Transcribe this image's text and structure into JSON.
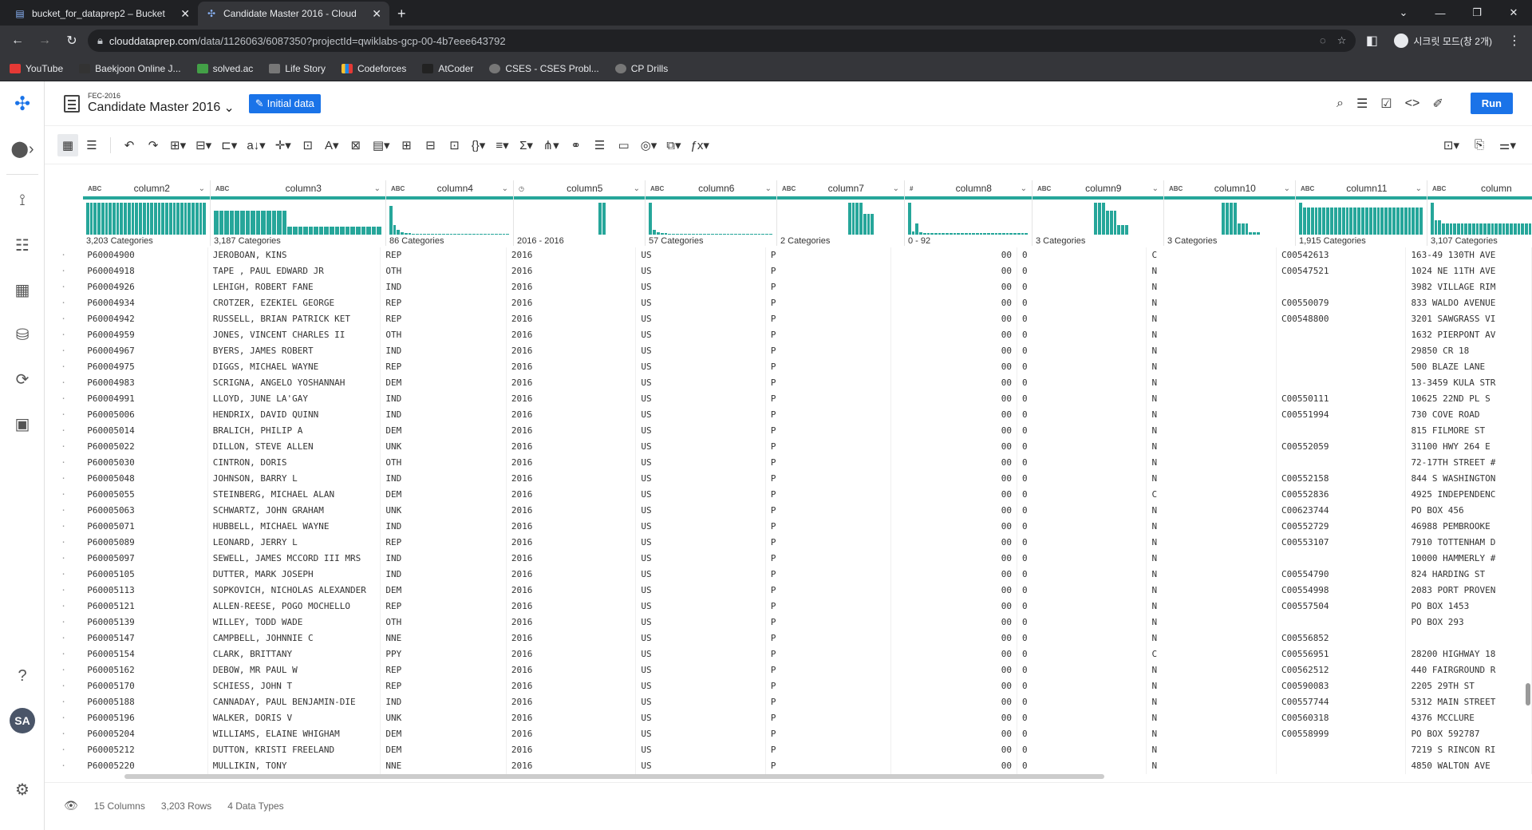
{
  "browser": {
    "tabs": [
      {
        "title": "bucket_for_dataprep2 – Bucket",
        "active": false
      },
      {
        "title": "Candidate Master 2016 - Cloud",
        "active": true
      }
    ],
    "url_host": "clouddataprep.com",
    "url_path": "/data/1126063/6087350?projectId=qwiklabs-gcp-00-4b7eee643792",
    "profile_label": "시크릿 모드(창 2개)",
    "bookmarks": [
      "YouTube",
      "Baekjoon Online J...",
      "solved.ac",
      "Life Story",
      "Codeforces",
      "AtCoder",
      "CSES - CSES Probl...",
      "CP Drills"
    ]
  },
  "header": {
    "dataset_sub": "FEC-2016",
    "dataset_title": "Candidate Master 2016",
    "initial_data_label": "Initial data",
    "run_label": "Run"
  },
  "leftnav": {
    "avatar": "SA"
  },
  "columns": [
    {
      "name": "column2",
      "type": "ABC",
      "summary": "3,203 Categories"
    },
    {
      "name": "column3",
      "type": "ABC",
      "summary": "3,187 Categories"
    },
    {
      "name": "column4",
      "type": "ABC",
      "summary": "86 Categories"
    },
    {
      "name": "column5",
      "type": "◷",
      "summary": "2016 - 2016"
    },
    {
      "name": "column6",
      "type": "ABC",
      "summary": "57 Categories"
    },
    {
      "name": "column7",
      "type": "ABC",
      "summary": "2 Categories"
    },
    {
      "name": "column8",
      "type": "#",
      "summary": "0 - 92"
    },
    {
      "name": "column9",
      "type": "ABC",
      "summary": "3 Categories"
    },
    {
      "name": "column10",
      "type": "ABC",
      "summary": "3 Categories"
    },
    {
      "name": "column11",
      "type": "ABC",
      "summary": "1,915 Categories"
    },
    {
      "name": "column",
      "type": "ABC",
      "summary": "3,107 Categories"
    }
  ],
  "rows": [
    [
      "P60004900",
      "JEROBOAN, KINS",
      "REP",
      "2016",
      "US",
      "P",
      "00",
      "0",
      "C",
      "C00542613",
      "163-49 130TH AVE"
    ],
    [
      "P60004918",
      "TAPE , PAUL EDWARD JR",
      "OTH",
      "2016",
      "US",
      "P",
      "00",
      "0",
      "N",
      "C00547521",
      "1024 NE 11TH AVE"
    ],
    [
      "P60004926",
      "LEHIGH, ROBERT FANE",
      "IND",
      "2016",
      "US",
      "P",
      "00",
      "0",
      "N",
      "",
      "3982 VILLAGE RIM"
    ],
    [
      "P60004934",
      "CROTZER, EZEKIEL GEORGE",
      "REP",
      "2016",
      "US",
      "P",
      "00",
      "0",
      "N",
      "C00550079",
      "833 WALDO AVENUE"
    ],
    [
      "P60004942",
      "RUSSELL, BRIAN PATRICK KET",
      "REP",
      "2016",
      "US",
      "P",
      "00",
      "0",
      "N",
      "C00548800",
      "3201 SAWGRASS VI"
    ],
    [
      "P60004959",
      "JONES, VINCENT CHARLES II",
      "OTH",
      "2016",
      "US",
      "P",
      "00",
      "0",
      "N",
      "",
      "1632 PIERPONT AV"
    ],
    [
      "P60004967",
      "BYERS, JAMES ROBERT",
      "IND",
      "2016",
      "US",
      "P",
      "00",
      "0",
      "N",
      "",
      "29850 CR 18"
    ],
    [
      "P60004975",
      "DIGGS, MICHAEL WAYNE",
      "REP",
      "2016",
      "US",
      "P",
      "00",
      "0",
      "N",
      "",
      "500 BLAZE LANE"
    ],
    [
      "P60004983",
      "SCRIGNA, ANGELO YOSHANNAH",
      "DEM",
      "2016",
      "US",
      "P",
      "00",
      "0",
      "N",
      "",
      "13-3459 KULA STR"
    ],
    [
      "P60004991",
      "LLOYD, JUNE LA'GAY",
      "IND",
      "2016",
      "US",
      "P",
      "00",
      "0",
      "N",
      "C00550111",
      "10625 22ND PL S"
    ],
    [
      "P60005006",
      "HENDRIX, DAVID QUINN",
      "IND",
      "2016",
      "US",
      "P",
      "00",
      "0",
      "N",
      "C00551994",
      "730 COVE ROAD"
    ],
    [
      "P60005014",
      "BRALICH, PHILIP A",
      "DEM",
      "2016",
      "US",
      "P",
      "00",
      "0",
      "N",
      "",
      "815 FILMORE ST"
    ],
    [
      "P60005022",
      "DILLON, STEVE ALLEN",
      "UNK",
      "2016",
      "US",
      "P",
      "00",
      "0",
      "N",
      "C00552059",
      "31100 HWY 264 E"
    ],
    [
      "P60005030",
      "CINTRON, DORIS",
      "OTH",
      "2016",
      "US",
      "P",
      "00",
      "0",
      "N",
      "",
      "72-17TH STREET #"
    ],
    [
      "P60005048",
      "JOHNSON, BARRY L",
      "IND",
      "2016",
      "US",
      "P",
      "00",
      "0",
      "N",
      "C00552158",
      "844 S WASHINGTON"
    ],
    [
      "P60005055",
      "STEINBERG, MICHAEL ALAN",
      "DEM",
      "2016",
      "US",
      "P",
      "00",
      "0",
      "C",
      "C00552836",
      "4925 INDEPENDENC"
    ],
    [
      "P60005063",
      "SCHWARTZ, JOHN GRAHAM",
      "UNK",
      "2016",
      "US",
      "P",
      "00",
      "0",
      "N",
      "C00623744",
      "PO BOX 456"
    ],
    [
      "P60005071",
      "HUBBELL, MICHAEL WAYNE",
      "IND",
      "2016",
      "US",
      "P",
      "00",
      "0",
      "N",
      "C00552729",
      "46988 PEMBROOKE"
    ],
    [
      "P60005089",
      "LEONARD, JERRY L",
      "REP",
      "2016",
      "US",
      "P",
      "00",
      "0",
      "N",
      "C00553107",
      "7910 TOTTENHAM D"
    ],
    [
      "P60005097",
      "SEWELL, JAMES MCCORD III MRS",
      "IND",
      "2016",
      "US",
      "P",
      "00",
      "0",
      "N",
      "",
      "10000 HAMMERLY #"
    ],
    [
      "P60005105",
      "DUTTER, MARK JOSEPH",
      "IND",
      "2016",
      "US",
      "P",
      "00",
      "0",
      "N",
      "C00554790",
      "824 HARDING ST"
    ],
    [
      "P60005113",
      "SOPKOVICH, NICHOLAS ALEXANDER",
      "DEM",
      "2016",
      "US",
      "P",
      "00",
      "0",
      "N",
      "C00554998",
      "2083 PORT PROVEN"
    ],
    [
      "P60005121",
      "ALLEN-REESE, POGO MOCHELLO",
      "REP",
      "2016",
      "US",
      "P",
      "00",
      "0",
      "N",
      "C00557504",
      "PO BOX 1453"
    ],
    [
      "P60005139",
      "WILLEY, TODD WADE",
      "OTH",
      "2016",
      "US",
      "P",
      "00",
      "0",
      "N",
      "",
      "PO BOX 293"
    ],
    [
      "P60005147",
      "CAMPBELL, JOHNNIE C",
      "NNE",
      "2016",
      "US",
      "P",
      "00",
      "0",
      "N",
      "C00556852",
      ""
    ],
    [
      "P60005154",
      "CLARK, BRITTANY",
      "PPY",
      "2016",
      "US",
      "P",
      "00",
      "0",
      "C",
      "C00556951",
      "28200 HIGHWAY 18"
    ],
    [
      "P60005162",
      "DEBOW, MR PAUL W",
      "REP",
      "2016",
      "US",
      "P",
      "00",
      "0",
      "N",
      "C00562512",
      "440 FAIRGROUND R"
    ],
    [
      "P60005170",
      "SCHIESS, JOHN T",
      "REP",
      "2016",
      "US",
      "P",
      "00",
      "0",
      "N",
      "C00590083",
      "2205 29TH ST"
    ],
    [
      "P60005188",
      "CANNADAY, PAUL BENJAMIN-DIE",
      "IND",
      "2016",
      "US",
      "P",
      "00",
      "0",
      "N",
      "C00557744",
      "5312 MAIN STREET"
    ],
    [
      "P60005196",
      "WALKER, DORIS V",
      "UNK",
      "2016",
      "US",
      "P",
      "00",
      "0",
      "N",
      "C00560318",
      "4376 MCCLURE"
    ],
    [
      "P60005204",
      "WILLIAMS, ELAINE WHIGHAM",
      "DEM",
      "2016",
      "US",
      "P",
      "00",
      "0",
      "N",
      "C00558999",
      "PO BOX 592787"
    ],
    [
      "P60005212",
      "DUTTON, KRISTI FREELAND",
      "DEM",
      "2016",
      "US",
      "P",
      "00",
      "0",
      "N",
      "",
      "7219 S RINCON RI"
    ],
    [
      "P60005220",
      "MULLIKIN, TONY",
      "NNE",
      "2016",
      "US",
      "P",
      "00",
      "0",
      "N",
      "",
      "4850 WALTON AVE"
    ]
  ],
  "footer": {
    "columns": "15 Columns",
    "rows": "3,203 Rows",
    "types": "4 Data Types"
  },
  "colors": {
    "accent": "#1a73e8",
    "histogram": "#26a69a"
  }
}
